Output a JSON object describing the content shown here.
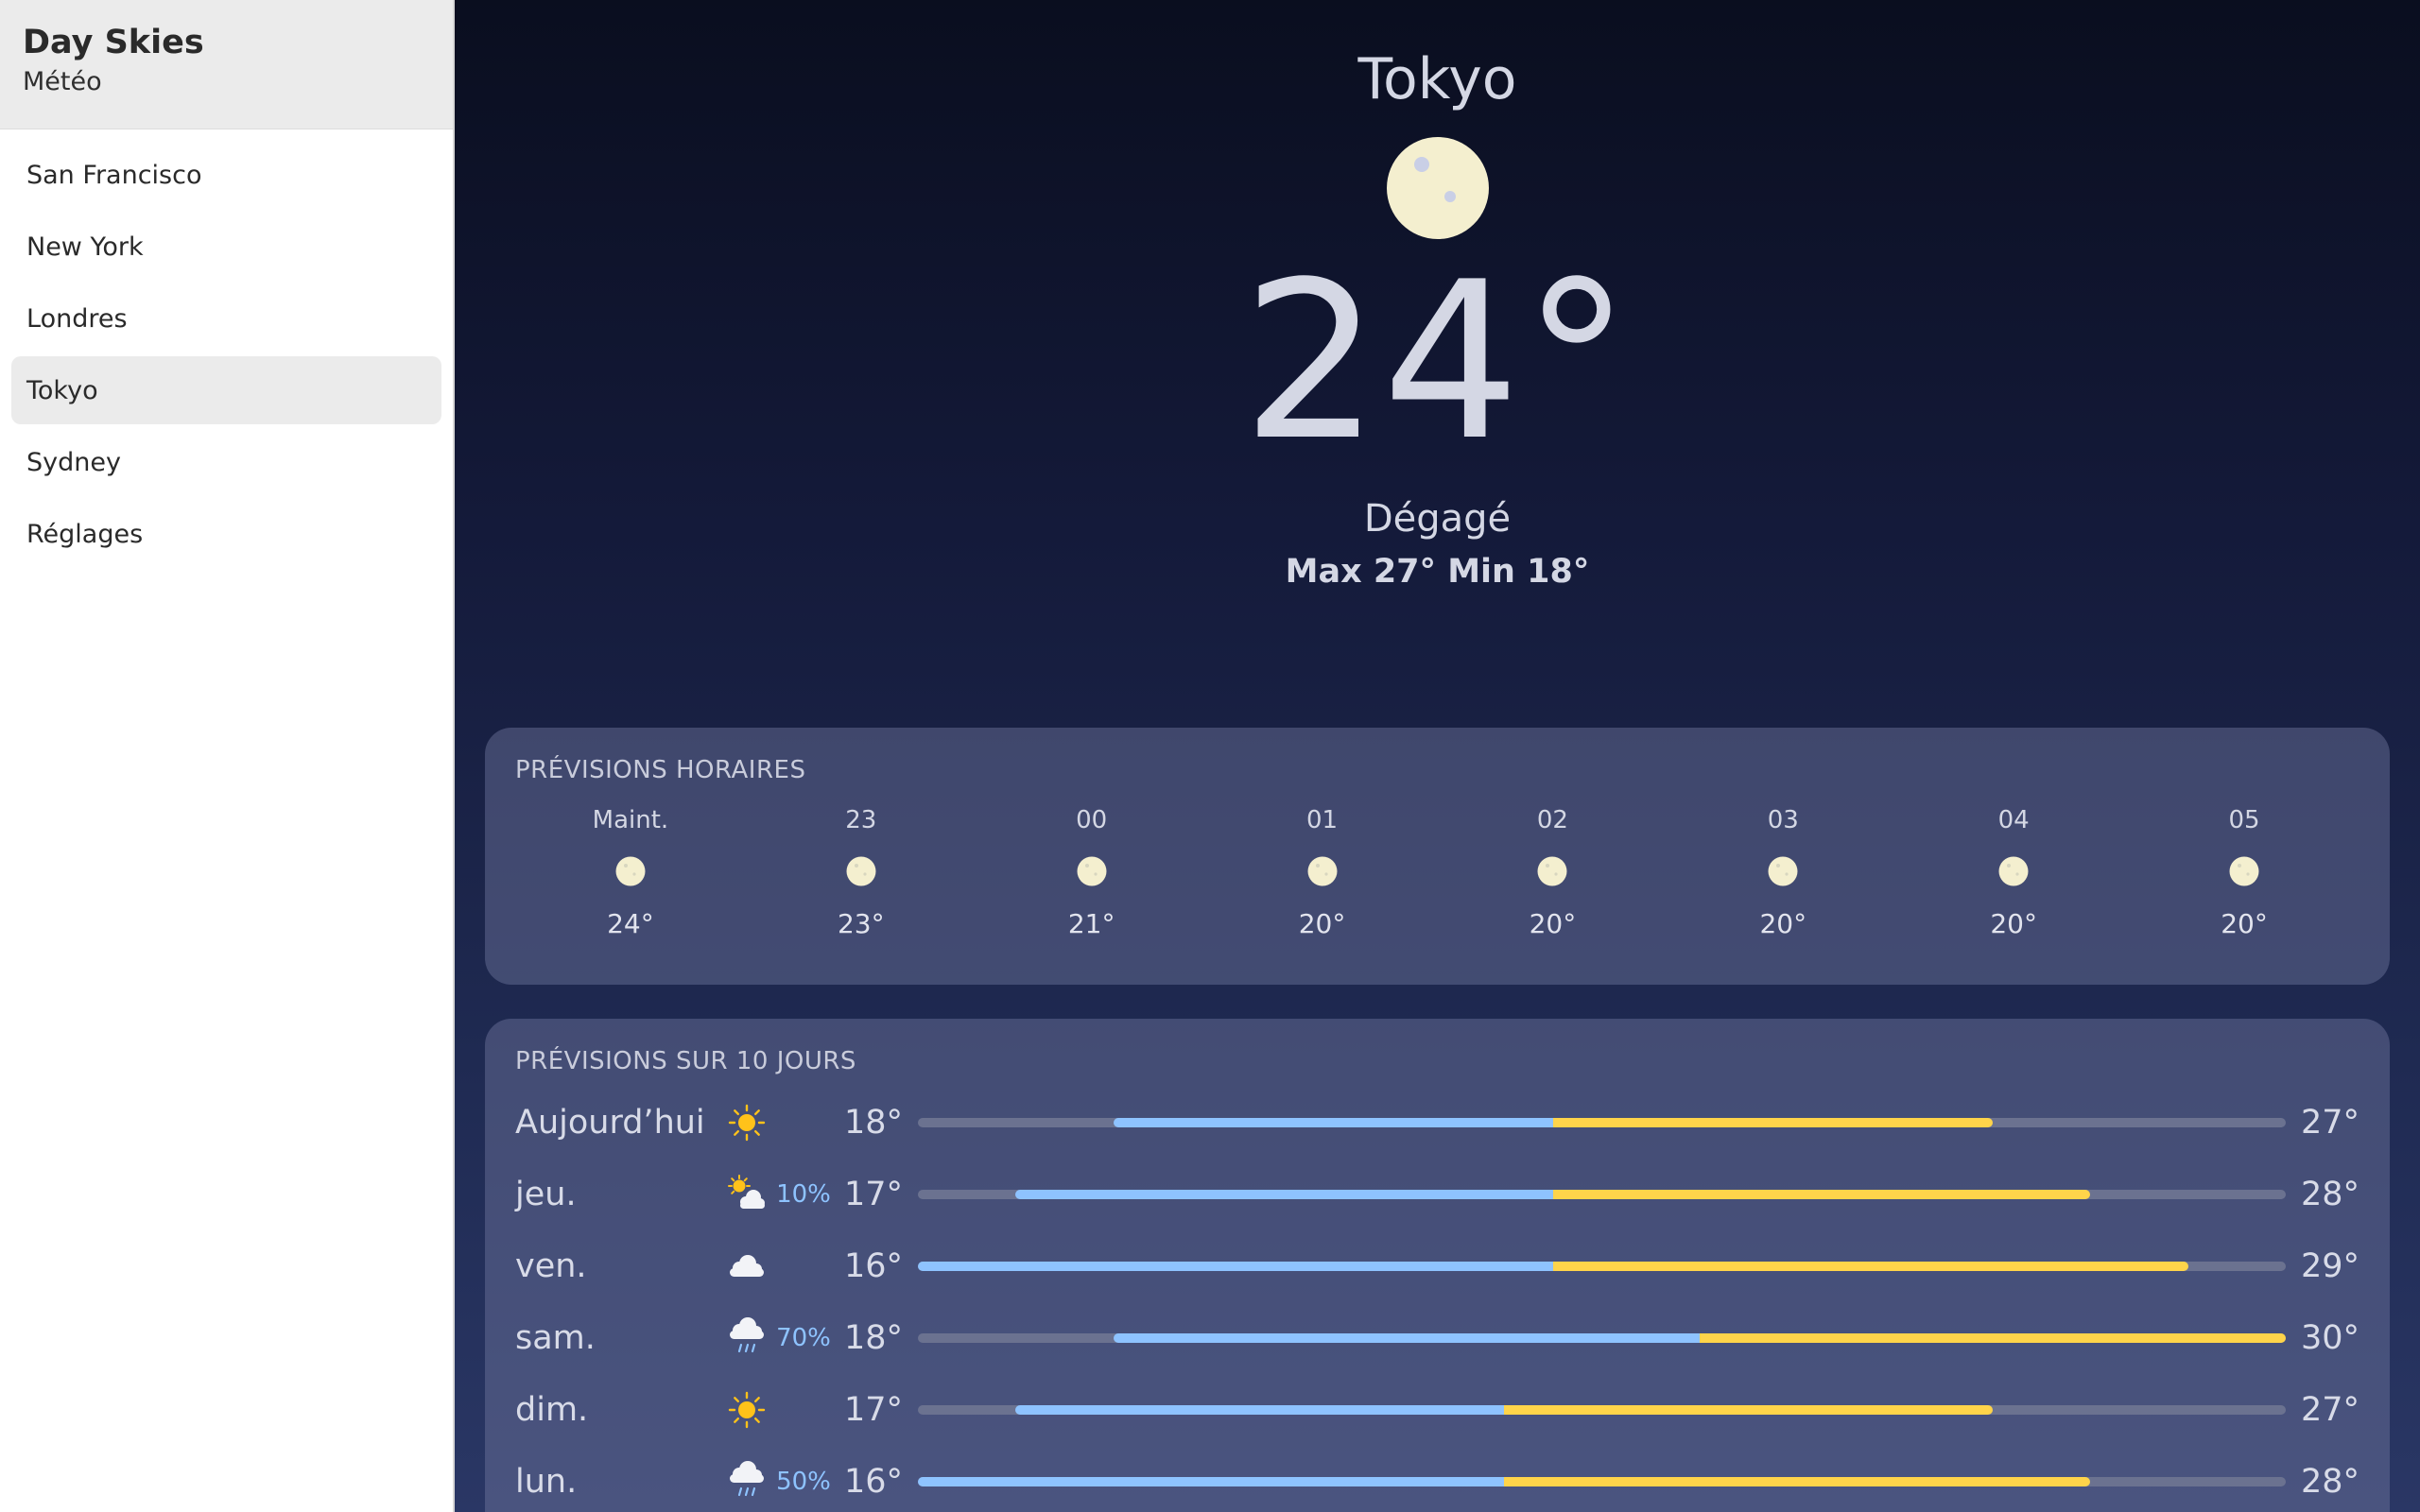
{
  "app": {
    "title": "Day Skies",
    "subtitle": "Météo"
  },
  "sidebar": {
    "items": [
      {
        "label": "San Francisco",
        "active": false
      },
      {
        "label": "New York",
        "active": false
      },
      {
        "label": "Londres",
        "active": false
      },
      {
        "label": "Tokyo",
        "active": true
      },
      {
        "label": "Sydney",
        "active": false
      },
      {
        "label": "Réglages",
        "active": false
      }
    ]
  },
  "current": {
    "city": "Tokyo",
    "icon": "moon-icon",
    "temp": "24°",
    "condition": "Dégagé",
    "hilo": "Max 27° Min 18°"
  },
  "hourly": {
    "title": "PRÉVISIONS HORAIRES",
    "hours": [
      {
        "label": "Maint.",
        "icon": "moon-icon",
        "temp": "24°"
      },
      {
        "label": "23",
        "icon": "moon-icon",
        "temp": "23°"
      },
      {
        "label": "00",
        "icon": "moon-icon",
        "temp": "21°"
      },
      {
        "label": "01",
        "icon": "moon-icon",
        "temp": "20°"
      },
      {
        "label": "02",
        "icon": "moon-icon",
        "temp": "20°"
      },
      {
        "label": "03",
        "icon": "moon-icon",
        "temp": "20°"
      },
      {
        "label": "04",
        "icon": "moon-icon",
        "temp": "20°"
      },
      {
        "label": "05",
        "icon": "moon-icon",
        "temp": "20°"
      }
    ]
  },
  "daily": {
    "title": "PRÉVISIONS SUR 10 JOURS",
    "range": {
      "min": 16,
      "max": 30
    },
    "colors": {
      "cold": "#8ec3ff",
      "warm": "#ffd44a",
      "track": "#6b7290"
    },
    "days": [
      {
        "name": "Aujourd’hui",
        "icon": "sun-icon",
        "precip": "",
        "min": "18°",
        "max": "27°",
        "lo": 18,
        "hi": 27
      },
      {
        "name": "jeu.",
        "icon": "sun-cloud-icon",
        "precip": "10%",
        "min": "17°",
        "max": "28°",
        "lo": 17,
        "hi": 28
      },
      {
        "name": "ven.",
        "icon": "cloud-icon",
        "precip": "",
        "min": "16°",
        "max": "29°",
        "lo": 16,
        "hi": 29
      },
      {
        "name": "sam.",
        "icon": "rain-icon",
        "precip": "70%",
        "min": "18°",
        "max": "30°",
        "lo": 18,
        "hi": 30
      },
      {
        "name": "dim.",
        "icon": "sun-icon",
        "precip": "",
        "min": "17°",
        "max": "27°",
        "lo": 17,
        "hi": 27
      },
      {
        "name": "lun.",
        "icon": "rain-icon",
        "precip": "50%",
        "min": "16°",
        "max": "28°",
        "lo": 16,
        "hi": 28
      }
    ]
  }
}
